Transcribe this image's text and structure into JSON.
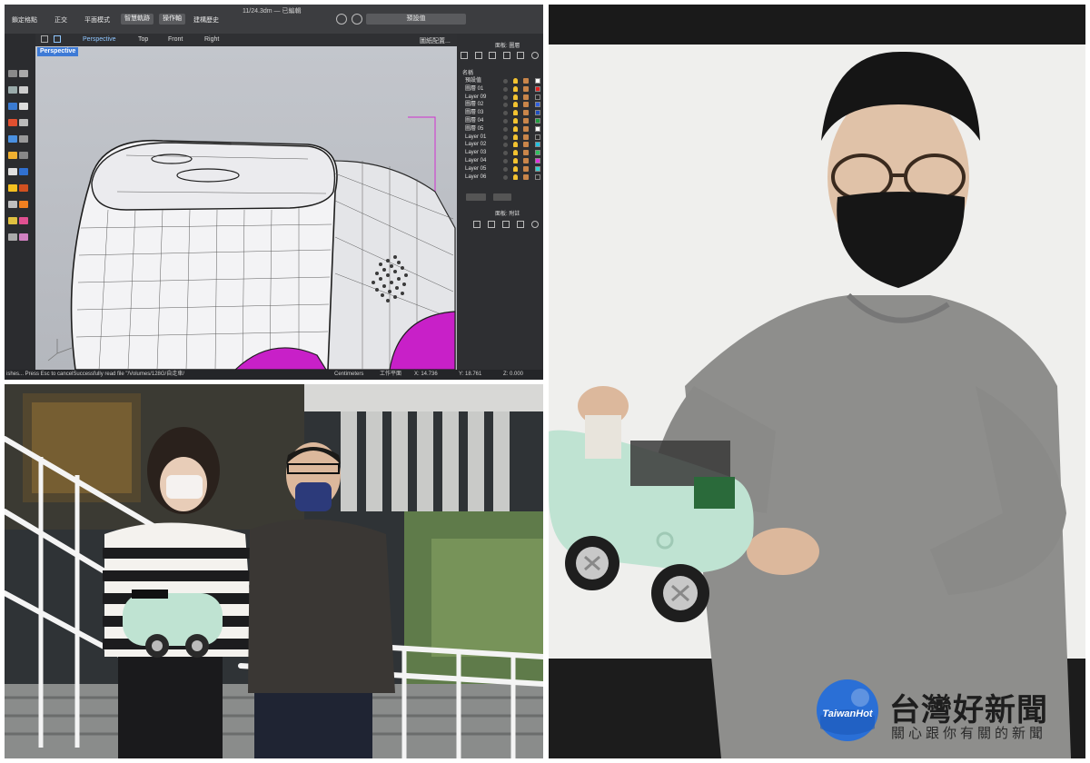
{
  "cad_app": {
    "toolbar": {
      "osnap_label": "鎖定格點",
      "ortho_label": "正交",
      "planar_label": "平面模式",
      "smarttrack_label": "智慧軌跡",
      "gumball_label": "操作軸",
      "history_label": "建構歷史"
    },
    "document_title": "11/24.3dm — 已編輯",
    "search_placeholder": "預設值",
    "tabs": [
      {
        "label": "Perspective",
        "active": true
      },
      {
        "label": "Top",
        "active": false
      },
      {
        "label": "Front",
        "active": false
      },
      {
        "label": "Right",
        "active": false
      }
    ],
    "viewport_config_label": "圖紙配置...",
    "active_viewport_label": "Perspective",
    "panel_layers_title": "面板: 圖層",
    "panel_attach_title": "面板: 附註",
    "layers_header": "名稱",
    "layers": [
      {
        "name": "預設值",
        "color": "#ffffff"
      },
      {
        "name": "圖層 01",
        "color": "#e02020"
      },
      {
        "name": "Layer 09",
        "color": "#2a2a2a"
      },
      {
        "name": "圖層 02",
        "color": "#3060e0"
      },
      {
        "name": "圖層 03",
        "color": "#2050c0"
      },
      {
        "name": "圖層 04",
        "color": "#20a040"
      },
      {
        "name": "圖層 05",
        "color": "#ffffff"
      },
      {
        "name": "Layer 01",
        "color": "#2a2a2a"
      },
      {
        "name": "Layer 02",
        "color": "#20c0e0"
      },
      {
        "name": "Layer 03",
        "color": "#30c060"
      },
      {
        "name": "Layer 04",
        "color": "#e030e0"
      },
      {
        "name": "Layer 05",
        "color": "#30d0d0"
      },
      {
        "name": "Layer 06",
        "color": "#2a2a2a"
      }
    ],
    "status": {
      "command_text": "ishes... Press Esc to cancelSuccessfully read file \"/Volumes/128G/自走車/",
      "units": "Centimeters",
      "cplane_label": "工作平面",
      "x_readout": "X: 14.736",
      "y_readout": "Y: 18.761",
      "z_readout": "Z: 0.000"
    }
  },
  "photos": {
    "accent_car_color": "#bfe3d2",
    "sweater_color": "#8e8e8c"
  },
  "watermark": {
    "logo_text": "TaiwanHot",
    "main_text": "台灣好新聞",
    "sub_text": "關心跟你有關的新聞",
    "brand_color": "#2a6fd6"
  }
}
